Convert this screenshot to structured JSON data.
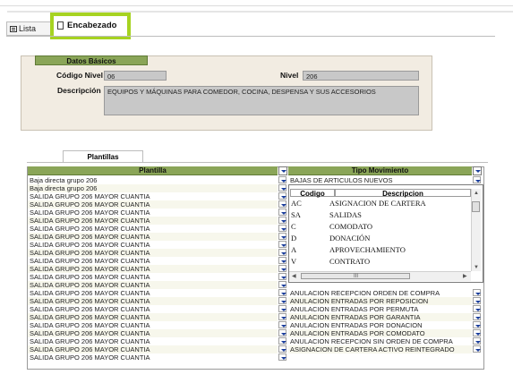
{
  "tabs": {
    "lista": "Lista",
    "encabezado": "Encabezado"
  },
  "datos_basicos": {
    "group_title": "Datos Básicos",
    "codigo_label": "Código Nivel",
    "codigo_value": "06",
    "nivel_label": "Nivel",
    "nivel_value": "206",
    "descripcion_label": "Descripción",
    "descripcion_value": "EQUIPOS Y MÁQUINAS PARA COMEDOR, COCINA, DESPENSA Y SUS ACCESORIOS"
  },
  "plantillas_tab": "Plantillas",
  "grid": {
    "col_plantilla": "Plantilla",
    "col_tipo": "Tipo Movimiento",
    "plantilla_rows": [
      "Baja directa grupo 206",
      "Baja directa grupo 206",
      "SALIDA GRUPO 206 MAYOR CUANTIA",
      "SALIDA GRUPO 206 MAYOR CUANTIA",
      "SALIDA GRUPO 206 MAYOR CUANTIA",
      "SALIDA GRUPO 206 MAYOR CUANTIA",
      "SALIDA GRUPO 206 MAYOR CUANTIA",
      "SALIDA GRUPO 206 MAYOR CUANTIA",
      "SALIDA GRUPO 206 MAYOR CUANTIA",
      "SALIDA GRUPO 206 MAYOR CUANTIA",
      "SALIDA GRUPO 206 MAYOR CUANTIA",
      "SALIDA GRUPO 206 MAYOR CUANTIA",
      "SALIDA GRUPO 206 MAYOR CUANTIA",
      "SALIDA GRUPO 206 MAYOR CUANTIA",
      "SALIDA GRUPO 206 MAYOR CUANTIA",
      "SALIDA GRUPO 206 MAYOR CUANTIA",
      "SALIDA GRUPO 206 MAYOR CUANTIA",
      "SALIDA GRUPO 206 MAYOR CUANTIA",
      "SALIDA GRUPO 206 MAYOR CUANTIA",
      "SALIDA GRUPO 206 MAYOR CUANTIA",
      "SALIDA GRUPO 206 MAYOR CUANTIA",
      "SALIDA GRUPO 206 MAYOR CUANTIA",
      "SALIDA GRUPO 206 MAYOR CUANTIA"
    ],
    "tipo_first": "BAJAS DE ARTICULOS NUEVOS",
    "tipo_rows": [
      "ANULACION RECEPCION ORDEN DE COMPRA",
      "ANULACION ENTRADAS POR REPOSICION",
      "ANULACION ENTRADAS POR PERMUTA",
      "ANULACION ENTRADAS POR GARANTIA",
      "ANULACION ENTRADAS POR DONACION",
      "ANULACION ENTRADAS POR COMODATO",
      "ANULACION RECEPCION SIN ORDEN DE COMPRA",
      "ASIGNACION DE CARTERA ACTIVO REINTEGRADO"
    ]
  },
  "popup": {
    "col_codigo": "Codigo",
    "col_descripcion": "Descripcion",
    "rows": [
      {
        "codigo": "AC",
        "descripcion": "ASIGNACION DE CARTERA"
      },
      {
        "codigo": "SA",
        "descripcion": "SALIDAS"
      },
      {
        "codigo": "C",
        "descripcion": "COMODATO"
      },
      {
        "codigo": "D",
        "descripcion": "DONACIÓN"
      },
      {
        "codigo": "A",
        "descripcion": "APROVECHAMIENTO"
      },
      {
        "codigo": "V",
        "descripcion": "CONTRATO"
      }
    ],
    "hscroll_glyph": "III"
  },
  "colors": {
    "header_green": "#8aa558",
    "highlight_green": "#a6d321",
    "panel_bg": "#f2ece2",
    "field_gray": "#c8c8c8"
  }
}
